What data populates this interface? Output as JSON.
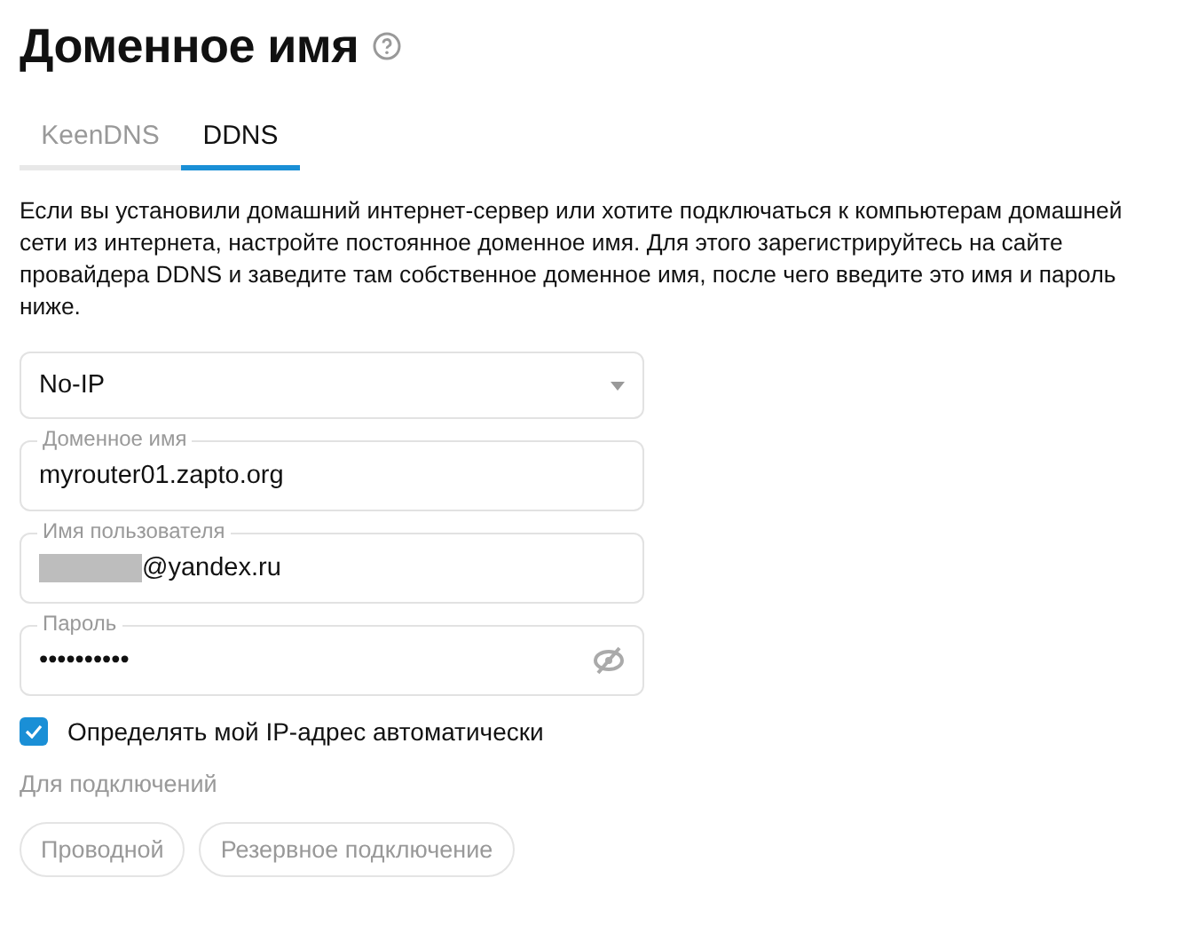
{
  "title": "Доменное имя",
  "tabs": [
    {
      "label": "KeenDNS",
      "selected": false
    },
    {
      "label": "DDNS",
      "selected": true
    }
  ],
  "description": "Если вы установили домашний интернет-сервер или хотите подключаться к компьютерам домашней сети из интернета, настройте постоянное доменное имя. Для этого зарегистрируйтесь на сайте провайдера DDNS и заведите там собственное доменное имя, после чего введите это имя и пароль ниже.",
  "provider": {
    "value": "No-IP"
  },
  "fields": [
    {
      "kind": "text",
      "label": "Доменное имя",
      "value": "myrouter01.zapto.org",
      "redacted": false
    },
    {
      "kind": "text",
      "label": "Имя пользователя",
      "value": "@yandex.ru",
      "redacted": true
    },
    {
      "kind": "password",
      "label": "Пароль",
      "value": "••••••••••",
      "redacted": false
    }
  ],
  "auto_ip": {
    "label": "Определять мой IP-адрес автоматически",
    "checked": true
  },
  "connections": {
    "label": "Для подключений",
    "chips": [
      {
        "label": "Проводной",
        "selected": false
      },
      {
        "label": "Резервное подключение",
        "selected": false
      }
    ]
  }
}
